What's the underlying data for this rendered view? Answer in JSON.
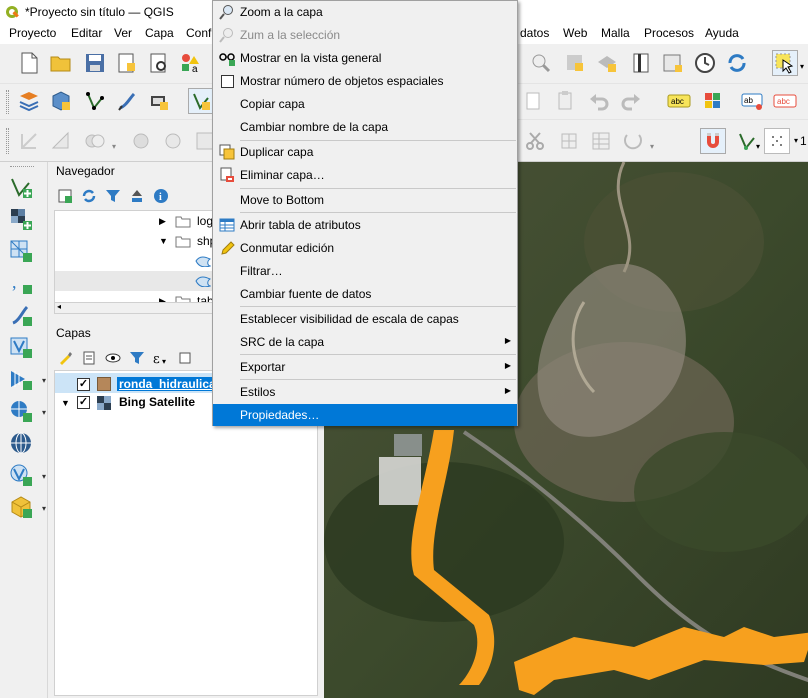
{
  "window": {
    "title": "*Proyecto sin título — QGIS"
  },
  "menubar": [
    "Proyecto",
    "Editar",
    "Ver",
    "Capa",
    "Conf",
    "datos",
    "Web",
    "Malla",
    "Procesos",
    "Ayuda"
  ],
  "toolbar3": {
    "scale_fragment": "1"
  },
  "navigator": {
    "title": "Navegador",
    "items": [
      "log",
      "shp",
      "tab"
    ]
  },
  "layers": {
    "title": "Capas",
    "items": [
      {
        "name": "ronda_hidraulica",
        "checked": true,
        "swatch": "#b5875a"
      },
      {
        "name": "Bing Satellite",
        "checked": true
      }
    ]
  },
  "context_menu": {
    "items": [
      {
        "label": "Zoom a la capa",
        "icon": "zoom-icon"
      },
      {
        "label": "Zum a la selección",
        "icon": "zoom-selection-icon",
        "disabled": true
      },
      {
        "label": "Mostrar en la vista general",
        "icon": "overview-glasses-icon"
      },
      {
        "label": "Mostrar número de objetos espaciales",
        "icon": "checkbox-icon"
      },
      {
        "label": "Copiar capa"
      },
      {
        "label": "Cambiar nombre de la capa"
      },
      {
        "label": "Duplicar capa",
        "icon": "duplicate-icon"
      },
      {
        "label": "Eliminar capa…",
        "icon": "delete-layer-icon"
      },
      {
        "label": "Move to Bottom"
      },
      {
        "label": "Abrir tabla de atributos",
        "icon": "attribute-table-icon"
      },
      {
        "label": "Conmutar edición",
        "icon": "pencil-icon"
      },
      {
        "label": "Filtrar…"
      },
      {
        "label": "Cambiar fuente de datos"
      },
      {
        "label": "Establecer visibilidad de escala de capas"
      },
      {
        "label": "SRC de la capa",
        "submenu": true
      },
      {
        "label": "Exportar",
        "submenu": true
      },
      {
        "label": "Estilos",
        "submenu": true
      },
      {
        "label": "Propiedades…",
        "highlighted": true
      }
    ]
  },
  "colors": {
    "accent": "#0078d7",
    "river": "#f7a01e"
  }
}
